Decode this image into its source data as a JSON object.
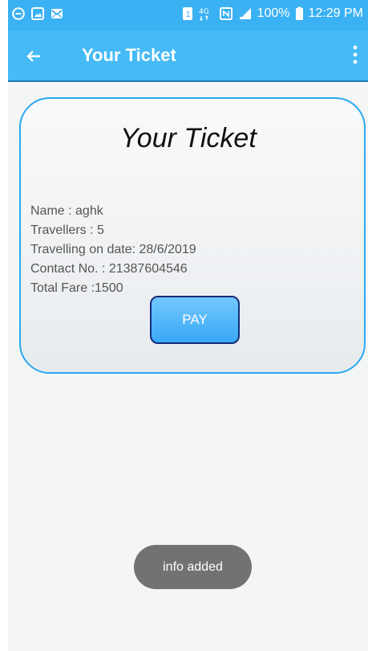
{
  "status_bar": {
    "battery": "100%",
    "time": "12:29 PM",
    "icons": [
      "circle-minus-icon",
      "image-icon",
      "mail-icon",
      "sim-icon",
      "4g-icon",
      "nfc-icon",
      "signal-icon",
      "battery-icon"
    ]
  },
  "app_bar": {
    "title": "Your Ticket",
    "left_icon": "back-arrow-icon",
    "right_icon": "more-vertical-icon"
  },
  "ticket": {
    "title": "Your Ticket",
    "lines": [
      "Name : aghk",
      "Travellers : 5",
      "Travelling on date:  28/6/2019",
      "Contact No. :  21387604546",
      "Total Fare :1500"
    ],
    "pay_label": "PAY"
  },
  "toast": {
    "message": "info added"
  },
  "colors": {
    "app_bar": "#45BAF6",
    "status_bar": "#3AB1F3",
    "card_border": "#2AA9F0",
    "button_border": "#142E79",
    "toast": "#727272"
  }
}
